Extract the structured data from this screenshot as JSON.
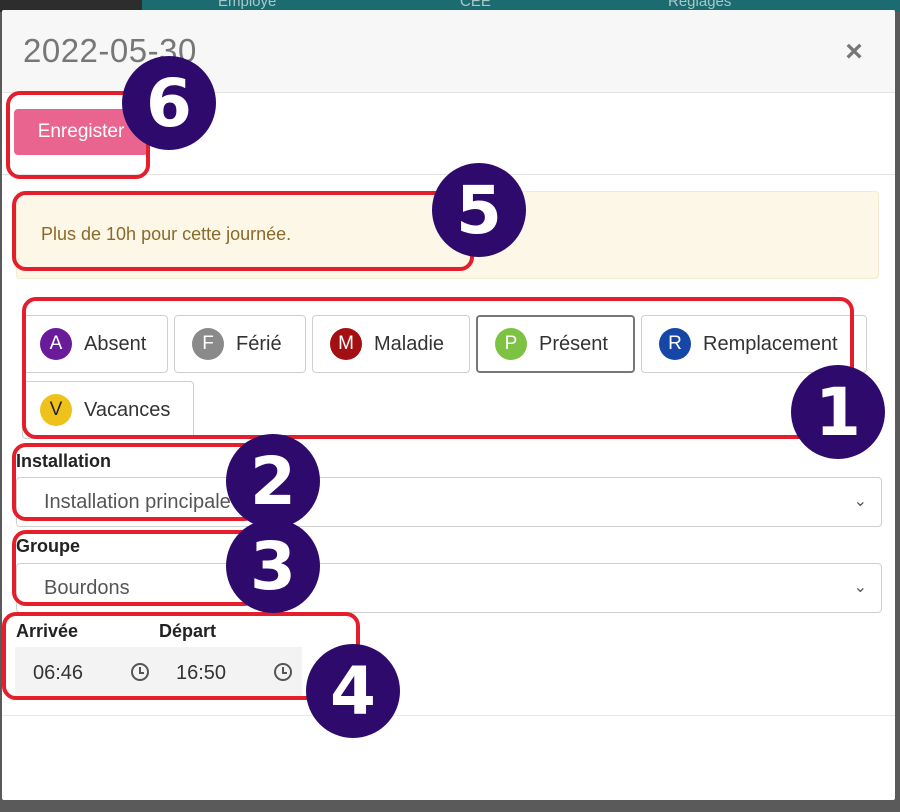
{
  "topbar": {
    "tabs": [
      "Employé",
      "CEE",
      "Réglages"
    ]
  },
  "modal": {
    "title": "2022-05-30",
    "close_icon": "close-icon"
  },
  "toolbar": {
    "save_label": "Enregister"
  },
  "alert": {
    "message": "Plus de 10h pour cette journée."
  },
  "statuses": [
    {
      "letter": "A",
      "label": "Absent",
      "color": "#6a1b9a",
      "selected": false
    },
    {
      "letter": "F",
      "label": "Férié",
      "color": "#8a8a8a",
      "selected": false
    },
    {
      "letter": "M",
      "label": "Maladie",
      "color": "#a30f12",
      "selected": false
    },
    {
      "letter": "P",
      "label": "Présent",
      "color": "#7dc242",
      "selected": true
    },
    {
      "letter": "R",
      "label": "Remplacement",
      "color": "#1747a6",
      "selected": false
    },
    {
      "letter": "V",
      "label": "Vacances",
      "color": "#efc21b",
      "selected": false
    }
  ],
  "form": {
    "installation_label": "Installation",
    "installation_value": "Installation principale",
    "groupe_label": "Groupe",
    "groupe_value": "Bourdons",
    "arrivee_label": "Arrivée",
    "arrivee_value": "06:46",
    "depart_label": "Départ",
    "depart_value": "16:50"
  },
  "annotations": [
    "1",
    "2",
    "3",
    "4",
    "5",
    "6"
  ],
  "colors": {
    "accent_pink": "#e9658f",
    "annotation_red": "#e41e2b",
    "marker_purple": "#2d0a6b"
  }
}
